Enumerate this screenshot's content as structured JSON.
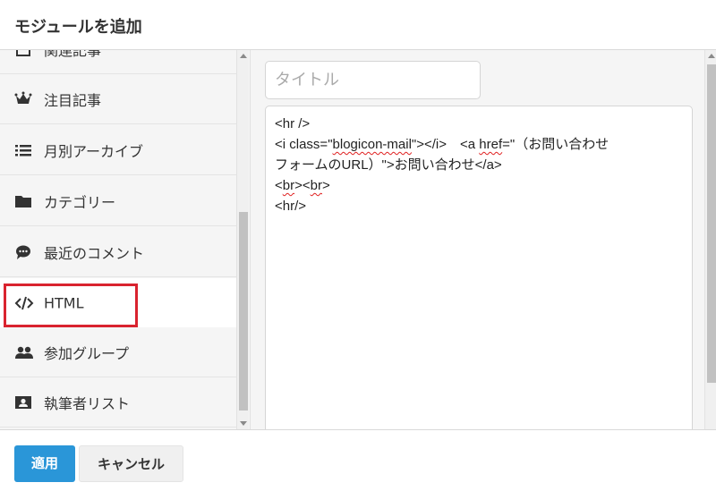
{
  "dialog": {
    "title": "モジュールを追加"
  },
  "sidebar": {
    "items": [
      {
        "label": "関連記事",
        "icon": "newspaper-icon"
      },
      {
        "label": "注目記事",
        "icon": "crown-icon"
      },
      {
        "label": "月別アーカイブ",
        "icon": "list-icon"
      },
      {
        "label": "カテゴリー",
        "icon": "folder-icon"
      },
      {
        "label": "最近のコメント",
        "icon": "comment-icon"
      },
      {
        "label": "HTML",
        "icon": "code-icon",
        "selected": true
      },
      {
        "label": "参加グループ",
        "icon": "users-icon"
      },
      {
        "label": "執筆者リスト",
        "icon": "id-card-icon"
      }
    ]
  },
  "editor": {
    "title_placeholder": "タイトル",
    "title_value": "",
    "code_lines": [
      "<hr />",
      "<i class=\"blogicon-mail\"></i>　<a href=\"（お問い合わせ",
      "フォームのURL）\">お問い合わせ</a>",
      "<br><br>",
      "<hr/>"
    ],
    "code_parts": {
      "l2_a": "<i class=\"",
      "l2_b": "blogicon-mail",
      "l2_c": "\"></i>　<a ",
      "l2_d": "href",
      "l2_e": "=\"（お問い合わせ",
      "l4_a": "<",
      "l4_b": "br",
      "l4_c": "><",
      "l4_d": "br",
      "l4_e": ">"
    }
  },
  "footer": {
    "apply_label": "適用",
    "cancel_label": "キャンセル"
  },
  "colors": {
    "accent": "#2a96d8",
    "highlight": "#d9232f"
  }
}
